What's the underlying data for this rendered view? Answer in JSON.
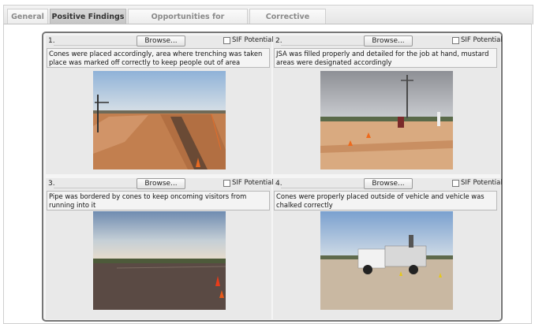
{
  "tabs": [
    {
      "label": "General",
      "active": false
    },
    {
      "label": "Positive Findings",
      "active": true
    },
    {
      "label": "Opportunities for Improvement",
      "active": false
    },
    {
      "label": "Corrective Actions",
      "active": false
    }
  ],
  "cells": [
    {
      "number": "1.",
      "browse_label": "Browse...",
      "sif_label": "SIF Potential",
      "sif_checked": false,
      "description": "Cones were placed accordingly, area where trenching was taken place was marked off correctly to keep people out of area"
    },
    {
      "number": "2.",
      "browse_label": "Browse...",
      "sif_label": "SIF Potential",
      "sif_checked": false,
      "description": "JSA was filled properly and detailed for the job at hand, mustard areas were designated accordingly"
    },
    {
      "number": "3.",
      "browse_label": "Browse...",
      "sif_label": "SIF Potential",
      "sif_checked": false,
      "description": "Pipe was bordered by cones to keep oncoming visitors from running into it"
    },
    {
      "number": "4.",
      "browse_label": "Browse...",
      "sif_label": "SIF Potential",
      "sif_checked": false,
      "description": "Cones were properly placed outside of vehicle and vehicle was chalked correctly"
    }
  ],
  "colors": {
    "accent_tab": "#c9c9c9",
    "panel_border": "#777777"
  }
}
